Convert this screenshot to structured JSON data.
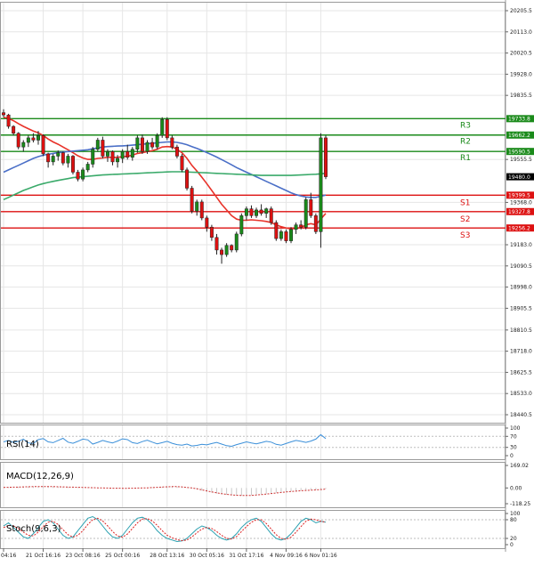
{
  "colors": {
    "resistance": "#1a8a1a",
    "support": "#dd1111",
    "bull_candle": "#1a8a1a",
    "bear_candle": "#dd1111",
    "ma_red": "#e8332a",
    "ma_blue": "#4a6fc7",
    "ma_green": "#3aaa6a",
    "rsi_line": "#3a8fd9",
    "macd_hist": "#cc3333",
    "stoch_k": "#2aa0b0",
    "stoch_d": "#dd2222",
    "grid": "#e6e6e6",
    "current_price_badge": "#000000"
  },
  "chart_data": [
    {
      "type": "candlestick",
      "panel": "price",
      "x_tick_labels": [
        "04:16",
        "21 Oct 16:16",
        "23 Oct 08:16",
        "25 Oct 00:16",
        "28 Oct 13:16",
        "30 Oct 05:16",
        "31 Oct 17:16",
        "4 Nov 09:16",
        "6 Nov 01:16"
      ],
      "y_tick_labels": [
        "20205.5",
        "20113.0",
        "20020.5",
        "19928.0",
        "19835.5",
        "19555.5",
        "19368.0",
        "19183.0",
        "19090.5",
        "18998.0",
        "18905.5",
        "18810.5",
        "18718.0",
        "18625.5",
        "18533.0",
        "18440.5"
      ],
      "ylim": [
        18440.5,
        20250
      ],
      "grid": true,
      "levels": [
        {
          "name": "R3",
          "value": 19733.8,
          "label": "19733.8",
          "kind": "resistance"
        },
        {
          "name": "R2",
          "value": 19662.2,
          "label": "19662.2",
          "kind": "resistance"
        },
        {
          "name": "R1",
          "value": 19590.5,
          "label": "19590.5",
          "kind": "resistance"
        },
        {
          "name": "S1",
          "value": 19399.5,
          "label": "19399.5",
          "kind": "support"
        },
        {
          "name": "S2",
          "value": 19327.8,
          "label": "19327.8",
          "kind": "support"
        },
        {
          "name": "S3",
          "value": 19256.2,
          "label": "19256.2",
          "kind": "support"
        }
      ],
      "current_price": {
        "value": 19480.0,
        "label": "19480.0"
      },
      "candles": [
        {
          "o": 19760,
          "h": 19775,
          "l": 19740,
          "c": 19750
        },
        {
          "o": 19750,
          "h": 19755,
          "l": 19690,
          "c": 19700
        },
        {
          "o": 19700,
          "h": 19705,
          "l": 19660,
          "c": 19670
        },
        {
          "o": 19670,
          "h": 19675,
          "l": 19600,
          "c": 19610
        },
        {
          "o": 19610,
          "h": 19640,
          "l": 19590,
          "c": 19630
        },
        {
          "o": 19630,
          "h": 19660,
          "l": 19610,
          "c": 19650
        },
        {
          "o": 19650,
          "h": 19670,
          "l": 19630,
          "c": 19640
        },
        {
          "o": 19640,
          "h": 19680,
          "l": 19620,
          "c": 19660
        },
        {
          "o": 19660,
          "h": 19665,
          "l": 19570,
          "c": 19580
        },
        {
          "o": 19580,
          "h": 19585,
          "l": 19520,
          "c": 19545
        },
        {
          "o": 19545,
          "h": 19580,
          "l": 19530,
          "c": 19570
        },
        {
          "o": 19570,
          "h": 19595,
          "l": 19550,
          "c": 19585
        },
        {
          "o": 19585,
          "h": 19590,
          "l": 19530,
          "c": 19540
        },
        {
          "o": 19540,
          "h": 19580,
          "l": 19520,
          "c": 19570
        },
        {
          "o": 19570,
          "h": 19575,
          "l": 19490,
          "c": 19500
        },
        {
          "o": 19500,
          "h": 19510,
          "l": 19460,
          "c": 19470
        },
        {
          "o": 19470,
          "h": 19520,
          "l": 19460,
          "c": 19510
        },
        {
          "o": 19510,
          "h": 19545,
          "l": 19500,
          "c": 19535
        },
        {
          "o": 19535,
          "h": 19610,
          "l": 19520,
          "c": 19600
        },
        {
          "o": 19600,
          "h": 19650,
          "l": 19590,
          "c": 19640
        },
        {
          "o": 19640,
          "h": 19655,
          "l": 19560,
          "c": 19570
        },
        {
          "o": 19570,
          "h": 19600,
          "l": 19545,
          "c": 19590
        },
        {
          "o": 19590,
          "h": 19595,
          "l": 19530,
          "c": 19545
        },
        {
          "o": 19545,
          "h": 19575,
          "l": 19520,
          "c": 19560
        },
        {
          "o": 19560,
          "h": 19600,
          "l": 19540,
          "c": 19590
        },
        {
          "o": 19590,
          "h": 19620,
          "l": 19555,
          "c": 19565
        },
        {
          "o": 19565,
          "h": 19610,
          "l": 19550,
          "c": 19600
        },
        {
          "o": 19600,
          "h": 19660,
          "l": 19585,
          "c": 19650
        },
        {
          "o": 19650,
          "h": 19665,
          "l": 19580,
          "c": 19590
        },
        {
          "o": 19590,
          "h": 19640,
          "l": 19580,
          "c": 19630
        },
        {
          "o": 19630,
          "h": 19650,
          "l": 19600,
          "c": 19610
        },
        {
          "o": 19610,
          "h": 19670,
          "l": 19600,
          "c": 19660
        },
        {
          "o": 19660,
          "h": 19740,
          "l": 19650,
          "c": 19730
        },
        {
          "o": 19730,
          "h": 19740,
          "l": 19640,
          "c": 19650
        },
        {
          "o": 19650,
          "h": 19660,
          "l": 19600,
          "c": 19610
        },
        {
          "o": 19610,
          "h": 19620,
          "l": 19560,
          "c": 19570
        },
        {
          "o": 19570,
          "h": 19580,
          "l": 19500,
          "c": 19510
        },
        {
          "o": 19510,
          "h": 19520,
          "l": 19420,
          "c": 19430
        },
        {
          "o": 19430,
          "h": 19440,
          "l": 19320,
          "c": 19330
        },
        {
          "o": 19330,
          "h": 19380,
          "l": 19310,
          "c": 19370
        },
        {
          "o": 19370,
          "h": 19380,
          "l": 19290,
          "c": 19300
        },
        {
          "o": 19300,
          "h": 19310,
          "l": 19240,
          "c": 19260
        },
        {
          "o": 19260,
          "h": 19270,
          "l": 19200,
          "c": 19215
        },
        {
          "o": 19215,
          "h": 19230,
          "l": 19140,
          "c": 19160
        },
        {
          "o": 19160,
          "h": 19170,
          "l": 19100,
          "c": 19140
        },
        {
          "o": 19140,
          "h": 19190,
          "l": 19130,
          "c": 19180
        },
        {
          "o": 19180,
          "h": 19185,
          "l": 19150,
          "c": 19160
        },
        {
          "o": 19160,
          "h": 19240,
          "l": 19150,
          "c": 19230
        },
        {
          "o": 19230,
          "h": 19320,
          "l": 19220,
          "c": 19310
        },
        {
          "o": 19310,
          "h": 19350,
          "l": 19290,
          "c": 19340
        },
        {
          "o": 19340,
          "h": 19355,
          "l": 19300,
          "c": 19310
        },
        {
          "o": 19310,
          "h": 19345,
          "l": 19300,
          "c": 19335
        },
        {
          "o": 19335,
          "h": 19360,
          "l": 19310,
          "c": 19320
        },
        {
          "o": 19320,
          "h": 19345,
          "l": 19300,
          "c": 19340
        },
        {
          "o": 19340,
          "h": 19350,
          "l": 19270,
          "c": 19280
        },
        {
          "o": 19280,
          "h": 19290,
          "l": 19200,
          "c": 19210
        },
        {
          "o": 19210,
          "h": 19250,
          "l": 19200,
          "c": 19240
        },
        {
          "o": 19240,
          "h": 19250,
          "l": 19190,
          "c": 19200
        },
        {
          "o": 19200,
          "h": 19260,
          "l": 19190,
          "c": 19250
        },
        {
          "o": 19250,
          "h": 19280,
          "l": 19230,
          "c": 19270
        },
        {
          "o": 19270,
          "h": 19290,
          "l": 19250,
          "c": 19260
        },
        {
          "o": 19260,
          "h": 19390,
          "l": 19250,
          "c": 19380
        },
        {
          "o": 19380,
          "h": 19410,
          "l": 19300,
          "c": 19310
        },
        {
          "o": 19310,
          "h": 19320,
          "l": 19230,
          "c": 19240
        },
        {
          "o": 19240,
          "h": 19670,
          "l": 19170,
          "c": 19650
        },
        {
          "o": 19650,
          "h": 19660,
          "l": 19470,
          "c": 19480
        }
      ],
      "moving_averages": [
        {
          "color_key": "ma_red",
          "values": [
            19740,
            19735,
            19725,
            19712,
            19700,
            19690,
            19680,
            19672,
            19660,
            19645,
            19632,
            19622,
            19610,
            19598,
            19585,
            19572,
            19562,
            19556,
            19556,
            19560,
            19562,
            19565,
            19565,
            19565,
            19568,
            19570,
            19574,
            19582,
            19585,
            19590,
            19594,
            19600,
            19610,
            19612,
            19610,
            19600,
            19585,
            19560,
            19530,
            19505,
            19478,
            19450,
            19420,
            19390,
            19360,
            19335,
            19310,
            19295,
            19290,
            19290,
            19292,
            19290,
            19288,
            19285,
            19280,
            19270,
            19262,
            19256,
            19252,
            19255,
            19258,
            19270,
            19275,
            19270,
            19295,
            19320
          ]
        },
        {
          "color_key": "ma_blue",
          "values": [
            19500,
            19510,
            19520,
            19530,
            19540,
            19550,
            19560,
            19568,
            19574,
            19578,
            19582,
            19586,
            19588,
            19590,
            19592,
            19594,
            19596,
            19598,
            19602,
            19606,
            19610,
            19612,
            19613,
            19614,
            19615,
            19616,
            19618,
            19620,
            19622,
            19624,
            19626,
            19628,
            19630,
            19632,
            19632,
            19630,
            19626,
            19620,
            19612,
            19604,
            19595,
            19586,
            19576,
            19566,
            19555,
            19544,
            19532,
            19520,
            19510,
            19500,
            19490,
            19480,
            19470,
            19460,
            19450,
            19440,
            19430,
            19420,
            19410,
            19402,
            19396,
            19392,
            19390,
            19390,
            19395,
            19400
          ]
        },
        {
          "color_key": "ma_green",
          "values": [
            19380,
            19390,
            19400,
            19410,
            19420,
            19428,
            19436,
            19444,
            19450,
            19455,
            19460,
            19464,
            19468,
            19472,
            19476,
            19478,
            19480,
            19482,
            19484,
            19486,
            19488,
            19489,
            19490,
            19491,
            19492,
            19493,
            19494,
            19495,
            19496,
            19497,
            19498,
            19499,
            19500,
            19501,
            19502,
            19502,
            19502,
            19501,
            19500,
            19499,
            19498,
            19497,
            19496,
            19495,
            19494,
            19493,
            19492,
            19491,
            19490,
            19489,
            19488,
            19487,
            19486,
            19486,
            19486,
            19486,
            19486,
            19486,
            19486,
            19487,
            19488,
            19489,
            19490,
            19491,
            19493,
            19495
          ]
        }
      ]
    },
    {
      "type": "line",
      "panel": "rsi",
      "title": "RSI(14)",
      "y_tick_labels": [
        "100",
        "70",
        "30",
        "0"
      ],
      "ylim": [
        0,
        100
      ],
      "series": [
        {
          "color_key": "rsi_line",
          "values": [
            50,
            55,
            48,
            52,
            60,
            46,
            44,
            58,
            62,
            50,
            47,
            55,
            63,
            49,
            45,
            52,
            60,
            57,
            42,
            48,
            55,
            50,
            46,
            53,
            61,
            58,
            47,
            44,
            51,
            56,
            49,
            43,
            47,
            52,
            45,
            40,
            38,
            42,
            35,
            37,
            41,
            39,
            44,
            48,
            42,
            36,
            34,
            40,
            45,
            50,
            46,
            43,
            47,
            52,
            49,
            41,
            38,
            44,
            50,
            55,
            52,
            48,
            53,
            60,
            76,
            62
          ]
        }
      ]
    },
    {
      "type": "bar",
      "panel": "macd",
      "title": "MACD(12,26,9)",
      "y_tick_labels": [
        "169.02",
        "0.00",
        "-118.25"
      ],
      "ylim": [
        -118.25,
        169.02
      ],
      "series": [
        {
          "color_key": "macd_hist",
          "values": [
            5,
            6,
            7,
            8,
            9,
            10,
            11,
            12,
            12,
            11,
            10,
            9,
            8,
            7,
            6,
            5,
            4,
            3,
            2,
            1,
            0,
            -1,
            -2,
            -3,
            -4,
            -3,
            -2,
            -1,
            0,
            2,
            4,
            6,
            8,
            10,
            12,
            10,
            6,
            2,
            -3,
            -10,
            -20,
            -28,
            -35,
            -42,
            -48,
            -52,
            -55,
            -57,
            -58,
            -57,
            -55,
            -52,
            -48,
            -44,
            -40,
            -36,
            -32,
            -28,
            -25,
            -22,
            -19,
            -17,
            -15,
            -13,
            -10,
            -6
          ]
        },
        {
          "color_key": "macd_hist",
          "values": [
            4,
            5,
            6,
            7,
            8,
            9,
            10,
            11,
            11,
            11,
            10,
            9,
            8,
            7,
            6,
            5,
            4,
            3,
            2,
            1,
            0,
            -1,
            -2,
            -2,
            -3,
            -3,
            -2,
            -1,
            0,
            1,
            3,
            5,
            7,
            9,
            10,
            10,
            8,
            4,
            0,
            -6,
            -14,
            -22,
            -30,
            -37,
            -43,
            -48,
            -52,
            -55,
            -57,
            -57,
            -56,
            -53,
            -50,
            -46,
            -42,
            -38,
            -34,
            -30,
            -27,
            -24,
            -21,
            -19,
            -17,
            -15,
            -12,
            -9
          ]
        }
      ]
    },
    {
      "type": "line",
      "panel": "stochastic",
      "title": "Stoch(9,6,3)",
      "y_tick_labels": [
        "100",
        "80",
        "20",
        "0"
      ],
      "ylim": [
        0,
        100
      ],
      "series": [
        {
          "color_key": "stoch_k",
          "values": [
            60,
            70,
            55,
            40,
            25,
            20,
            35,
            55,
            75,
            80,
            70,
            50,
            30,
            20,
            25,
            45,
            65,
            85,
            90,
            80,
            60,
            40,
            25,
            20,
            30,
            50,
            70,
            85,
            88,
            80,
            65,
            45,
            30,
            20,
            15,
            10,
            12,
            20,
            35,
            50,
            60,
            55,
            45,
            30,
            20,
            15,
            20,
            35,
            55,
            70,
            80,
            85,
            75,
            55,
            35,
            20,
            15,
            20,
            35,
            55,
            75,
            85,
            80,
            70,
            75,
            72
          ]
        },
        {
          "color_key": "stoch_d",
          "values": [
            55,
            62,
            60,
            52,
            40,
            30,
            28,
            40,
            58,
            72,
            75,
            65,
            48,
            32,
            24,
            30,
            45,
            65,
            80,
            85,
            76,
            60,
            42,
            28,
            24,
            34,
            52,
            70,
            82,
            84,
            76,
            62,
            45,
            30,
            22,
            16,
            13,
            15,
            25,
            38,
            50,
            55,
            52,
            42,
            30,
            20,
            18,
            26,
            42,
            58,
            72,
            80,
            80,
            68,
            50,
            32,
            20,
            17,
            24,
            40,
            58,
            75,
            82,
            80,
            75,
            72
          ]
        }
      ]
    }
  ]
}
